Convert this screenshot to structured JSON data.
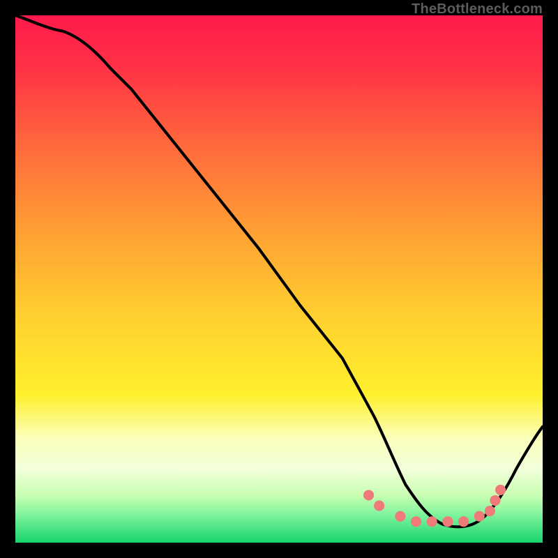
{
  "watermark": "TheBottleneck.com",
  "chart_data": {
    "type": "line",
    "title": "",
    "xlabel": "",
    "ylabel": "",
    "xlim": [
      0,
      100
    ],
    "ylim": [
      0,
      100
    ],
    "grid": false,
    "legend": false,
    "background_gradient": {
      "top": "#ff1a4b",
      "middle": "#ffe733",
      "bottom": "#17d36b",
      "pale_band": "#fbffe1"
    },
    "series": [
      {
        "name": "bottleneck-curve",
        "color": "#000000",
        "x": [
          0,
          4,
          9,
          14,
          22,
          30,
          38,
          46,
          54,
          62,
          68,
          72,
          76,
          80,
          84,
          88,
          92,
          96,
          100
        ],
        "y": [
          100,
          99,
          97,
          94,
          86,
          76,
          66,
          56,
          45,
          35,
          24,
          15,
          8,
          4,
          3,
          4,
          8,
          15,
          22
        ]
      },
      {
        "name": "markers",
        "type": "scatter",
        "color": "#ef6f6f",
        "x": [
          67,
          69,
          73,
          76,
          79,
          82,
          85,
          88,
          90,
          91,
          92
        ],
        "y": [
          9,
          7,
          5,
          4,
          4,
          4,
          4,
          5,
          6,
          8,
          10
        ]
      }
    ]
  }
}
